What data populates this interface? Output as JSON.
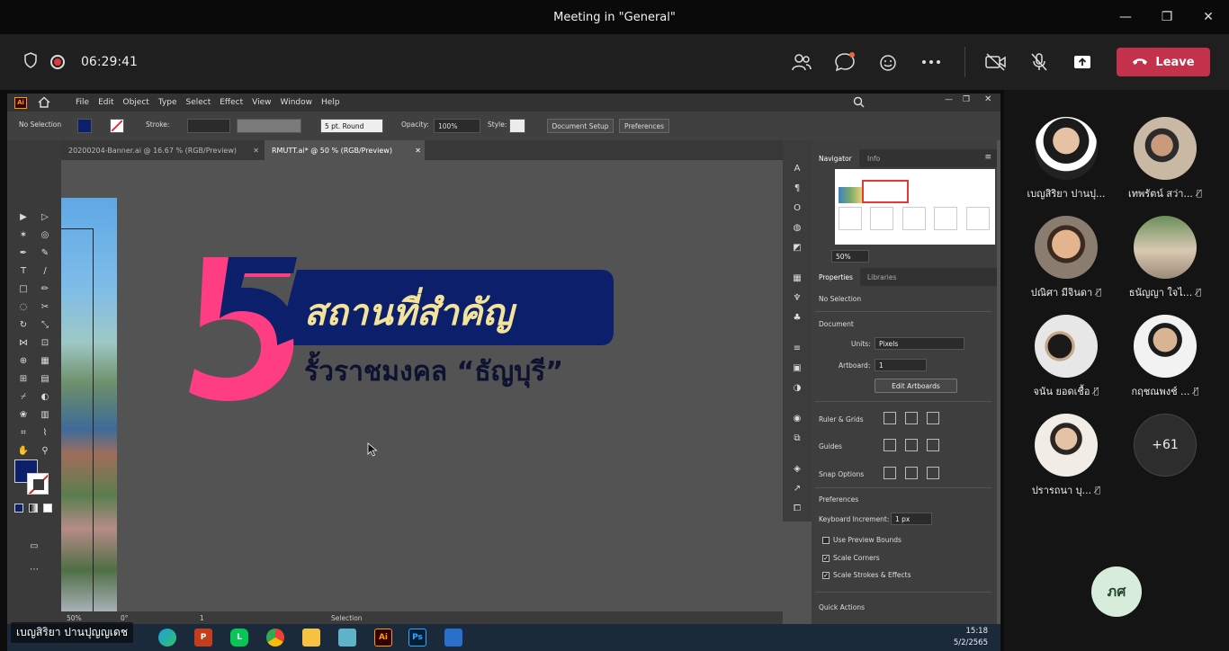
{
  "window": {
    "title": "Meeting in \"General\"",
    "controls": [
      "—",
      "❐",
      "✕"
    ]
  },
  "meeting": {
    "timer": "06:29:41",
    "leave_label": "Leave"
  },
  "illustrator": {
    "menu": [
      "File",
      "Edit",
      "Object",
      "Type",
      "Select",
      "Effect",
      "View",
      "Window",
      "Help"
    ],
    "control": {
      "selection": "No Selection",
      "stroke_label": "Stroke:",
      "brush": "5 pt. Round",
      "opacity_label": "Opacity:",
      "opacity": "100%",
      "style_label": "Style:",
      "document_setup": "Document Setup",
      "preferences": "Preferences"
    },
    "tabs": [
      {
        "label": "20200204-Banner.ai @ 16.67 % (RGB/Preview)"
      },
      {
        "label": "RMUTT.ai* @ 50 % (RGB/Preview)"
      }
    ],
    "artwork": {
      "number": "5",
      "title_th": "สถานที่สำคัญ",
      "subtitle_th": "รั้วราชมงคล “ธัญบุรี”"
    },
    "status": {
      "zoom": "50%",
      "rotation": "0°",
      "artboard": "1",
      "tool": "Selection"
    },
    "navigator": {
      "tabs": [
        "Navigator",
        "Info"
      ],
      "zoom": "50%"
    },
    "properties": {
      "tabs": [
        "Properties",
        "Libraries"
      ],
      "no_selection": "No Selection",
      "document": "Document",
      "units_label": "Units:",
      "units": "Pixels",
      "artboard_label": "Artboard:",
      "artboard": "1",
      "edit_artboards": "Edit Artboards",
      "rulers": "Ruler & Grids",
      "guides": "Guides",
      "snap": "Snap Options",
      "preferences": "Preferences",
      "keyboard_label": "Keyboard Increment:",
      "keyboard": "1 px",
      "use_preview_bounds": "Use Preview Bounds",
      "scale_corners": "Scale Corners",
      "scale_strokes": "Scale Strokes & Effects",
      "quick_actions": "Quick Actions"
    }
  },
  "taskbar": {
    "time": "15:18",
    "date": "5/2/2565",
    "apps": [
      "Edge",
      "PowerPoint",
      "LINE",
      "Chrome",
      "Explorer",
      "Notes",
      "Ai",
      "Ps",
      "Photos"
    ]
  },
  "presenter_name": "เบญสิริยา ปานปุญญเดช",
  "participants": [
    {
      "name": "เบญสิริยา ปานปุ...",
      "muted": false
    },
    {
      "name": "เทพรัตน์ สว่า...",
      "muted": true
    },
    {
      "name": "ปณิศา มีจินดา",
      "muted": true
    },
    {
      "name": "ธนัญญา ใจไ...",
      "muted": true
    },
    {
      "name": "จนัน ยอดเชื้อ",
      "muted": true
    },
    {
      "name": "กฤชณพงช์ ...",
      "muted": true
    },
    {
      "name": "ปรารถนา บุ...",
      "muted": true
    }
  ],
  "more_count": "+61",
  "self_initials": "ภศ",
  "colors": {
    "leave": "#c4314b",
    "banner_navy": "#0b1f6b",
    "banner_yellow": "#f4e39a",
    "five_pink": "#ff3d83"
  }
}
